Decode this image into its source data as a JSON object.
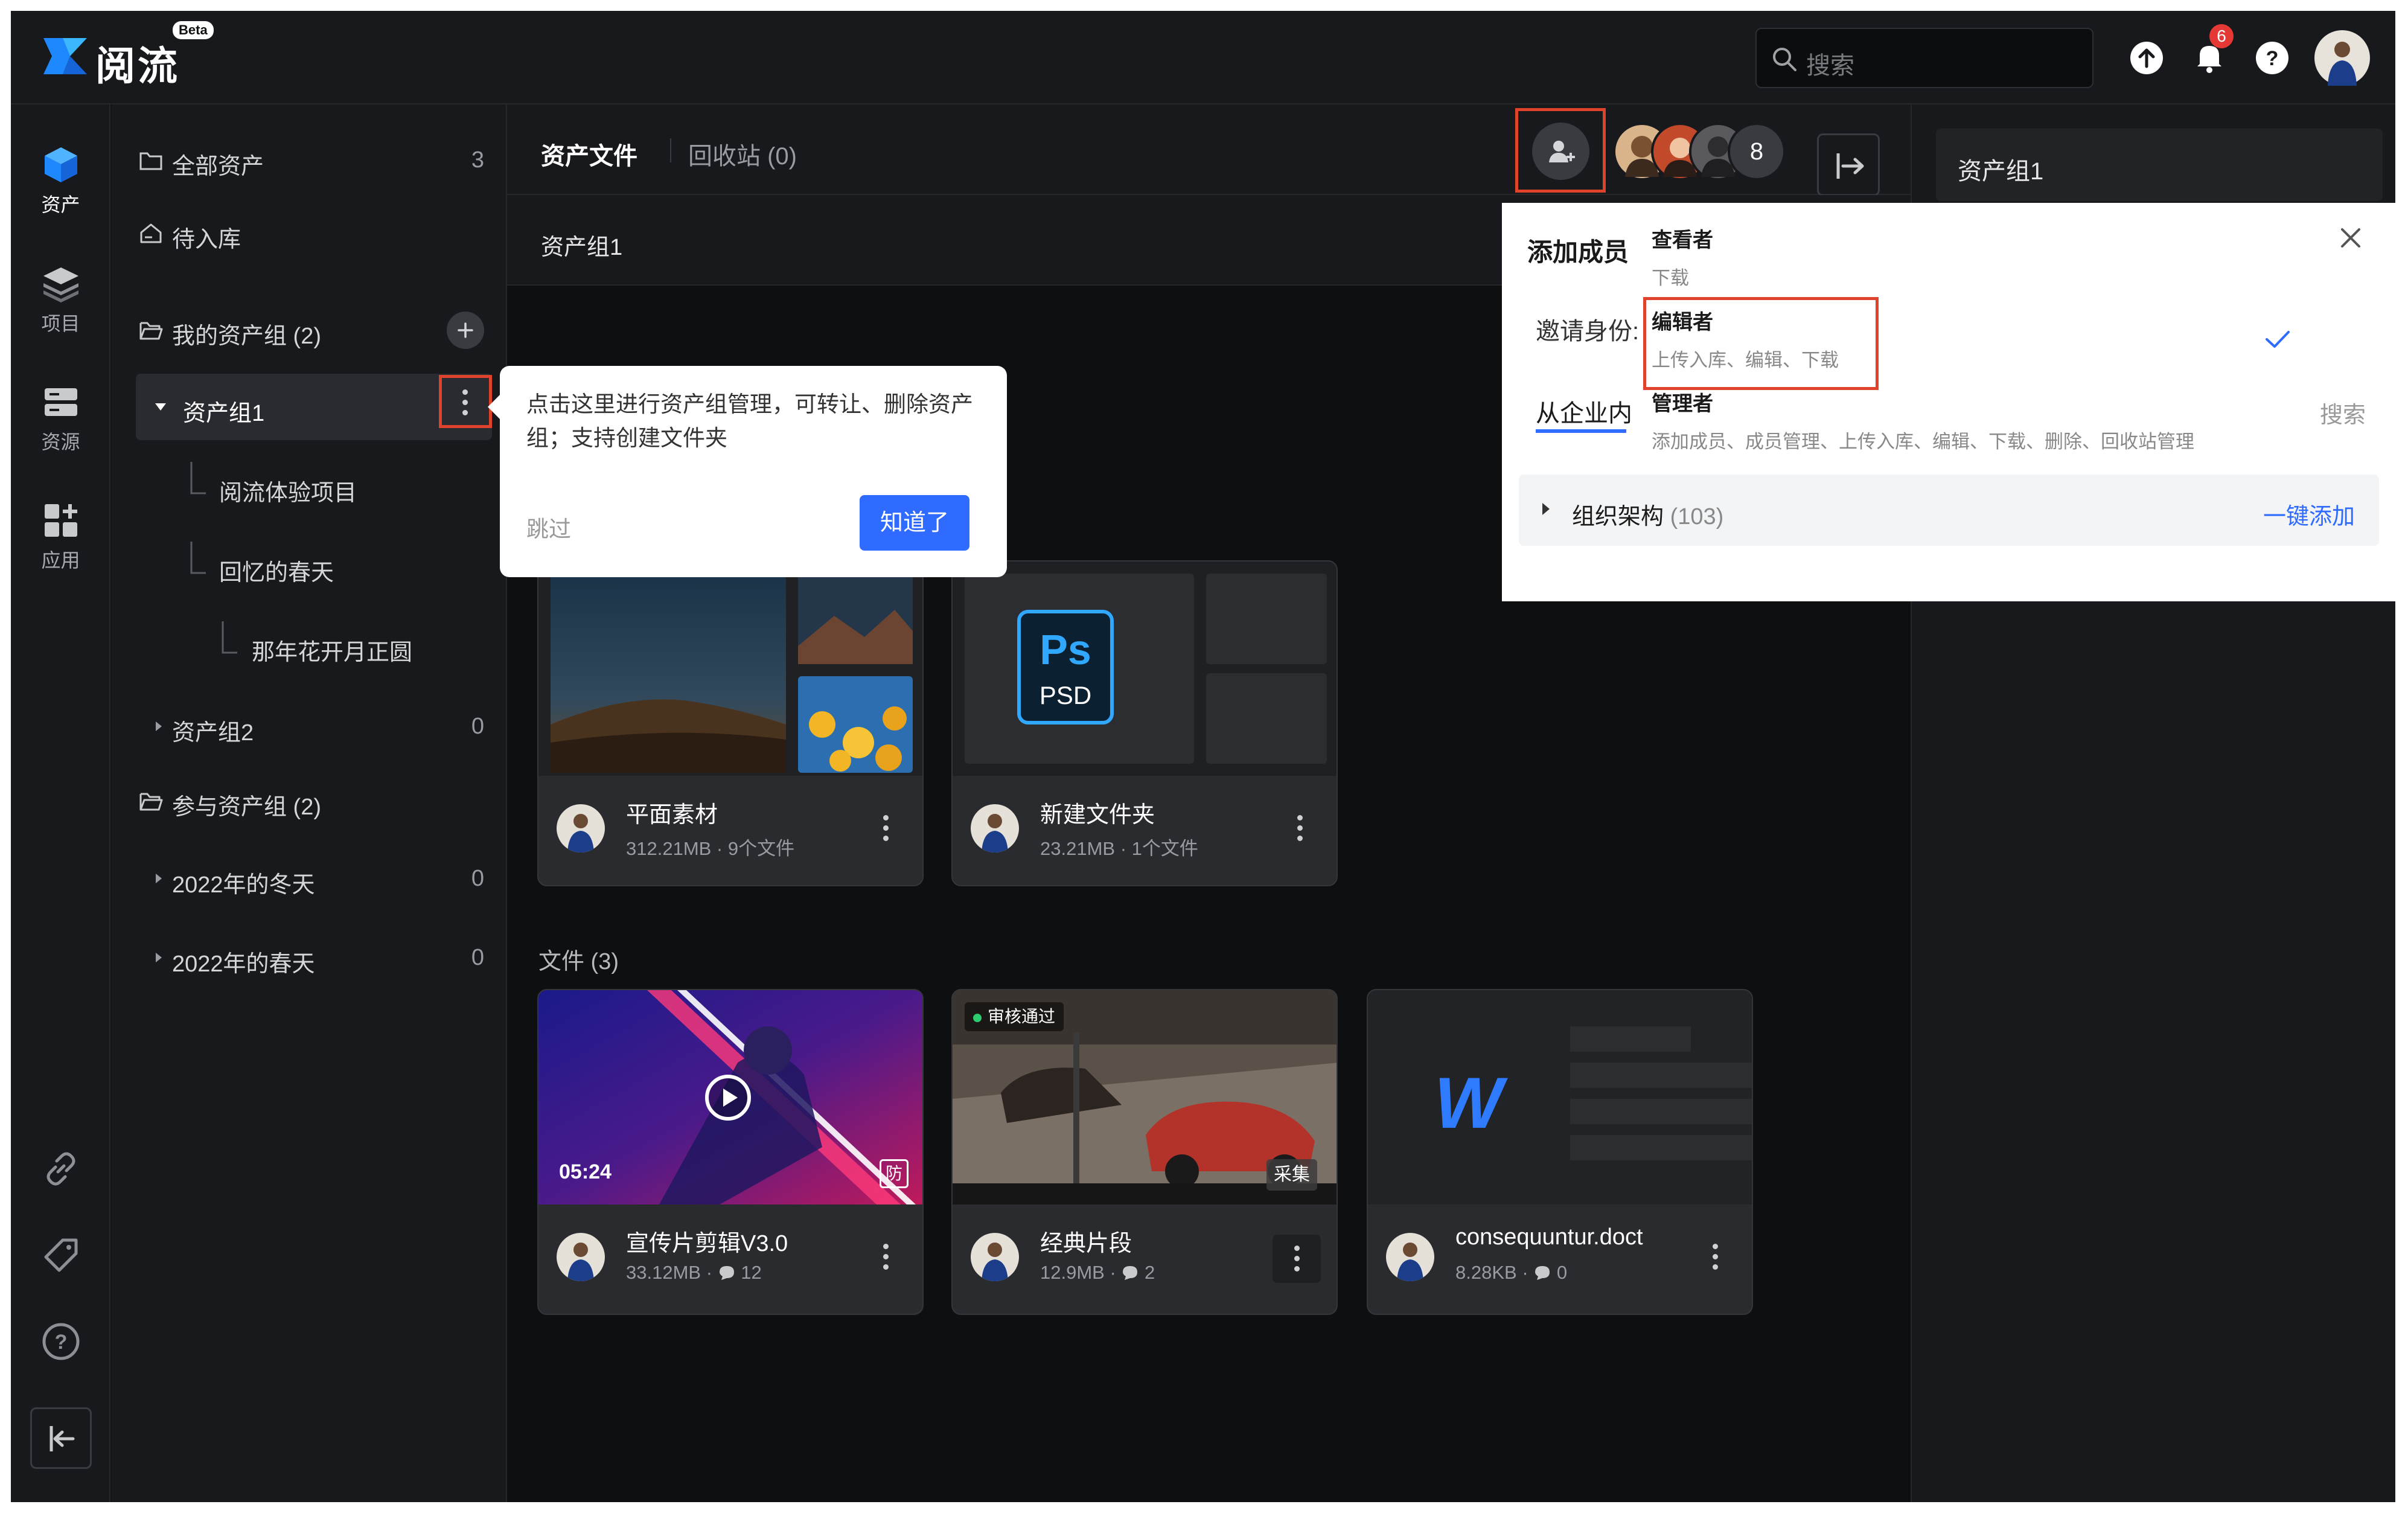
{
  "app": {
    "brand": "阅流",
    "beta": "Beta"
  },
  "topbar": {
    "search_placeholder": "搜索",
    "notifications_count": "6"
  },
  "rail": [
    {
      "label": "资产",
      "icon": "cube-icon"
    },
    {
      "label": "项目",
      "icon": "layers-icon"
    },
    {
      "label": "资源",
      "icon": "server-icon"
    },
    {
      "label": "应用",
      "icon": "apps-icon"
    }
  ],
  "tree": {
    "all_assets": {
      "label": "全部资产",
      "count": "3"
    },
    "pending": {
      "label": "待入库"
    },
    "my_groups": {
      "label": "我的资产组 (2)"
    },
    "group1": {
      "label": "资产组1"
    },
    "g1_children": [
      "阅流体验项目",
      "回忆的春天",
      "那年花开月正圆"
    ],
    "group2": {
      "label": "资产组2",
      "count": "0"
    },
    "joined_groups": {
      "label": "参与资产组 (2)"
    },
    "joined": [
      {
        "label": "2022年的冬天",
        "count": "0"
      },
      {
        "label": "2022年的春天",
        "count": "0"
      }
    ]
  },
  "main": {
    "tab_assets": "资产文件",
    "tab_recycle": "回收站 (0)",
    "member_count": "8",
    "breadcrumb": "资产组1",
    "files_header": "文件 (3)"
  },
  "folders": [
    {
      "name": "平面素材",
      "meta": "312.21MB · 9个文件"
    },
    {
      "name": "新建文件夹",
      "meta": "23.21MB · 1个文件",
      "icon_label": "Ps",
      "icon_sub": "PSD"
    }
  ],
  "files": [
    {
      "name": "宣传片剪辑V3.0",
      "size": "33.12MB",
      "comments": "12",
      "duration": "05:24",
      "tag": "防"
    },
    {
      "name": "经典片段",
      "size": "12.9MB",
      "comments": "2",
      "status": "审核通过",
      "tag": "采集"
    },
    {
      "name": "consequuntur.doct",
      "size": "8.28KB",
      "comments": "0",
      "icon_label": "W"
    }
  ],
  "tooltip": {
    "text": "点击这里进行资产组管理，可转让、删除资产组；支持创建文件夹",
    "skip": "跳过",
    "ok": "知道了"
  },
  "add_member": {
    "title": "添加成员",
    "invite_label": "邀请身份:",
    "tab_enterprise": "从企业内",
    "search_hint": "搜索",
    "roles": [
      {
        "name": "查看者",
        "desc": "下载"
      },
      {
        "name": "编辑者",
        "desc": "上传入库、编辑、下载"
      },
      {
        "name": "管理者",
        "desc": "添加成员、成员管理、上传入库、编辑、下载、删除、回收站管理"
      }
    ],
    "org_label": "组织架构",
    "org_count": "(103)",
    "add_all": "一键添加"
  },
  "right_panel": {
    "title": "资产组1"
  },
  "colors": {
    "accent": "#2f6bff",
    "highlight": "#e0432b",
    "link": "#2f6bff"
  }
}
